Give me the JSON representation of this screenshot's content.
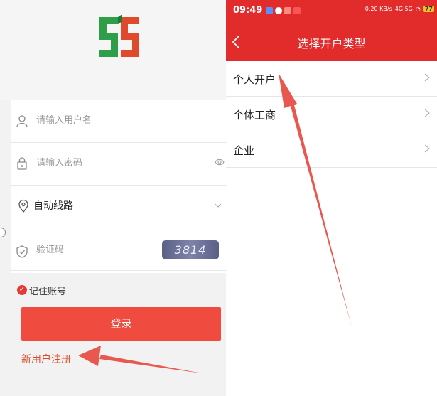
{
  "login_screen": {
    "username_placeholder": "请输入用户名",
    "password_placeholder": "请输入密码",
    "route_value": "自动线路",
    "captcha_placeholder": "验证码",
    "captcha_code": "3814",
    "remember_label": "记住账号",
    "login_button": "登录",
    "register_link": "新用户注册"
  },
  "account_type_screen": {
    "status_time": "09:49",
    "status_speed": "0.20 KB/s",
    "status_network": "4G 5G",
    "battery_level": "77",
    "title": "选择开户类型",
    "items": [
      {
        "label": "个人开户"
      },
      {
        "label": "个体工商"
      },
      {
        "label": "企业"
      }
    ]
  },
  "colors": {
    "brand_red": "#e22b2b",
    "button_red": "#ef4b3f",
    "annotation_arrow": "#e8584f"
  }
}
